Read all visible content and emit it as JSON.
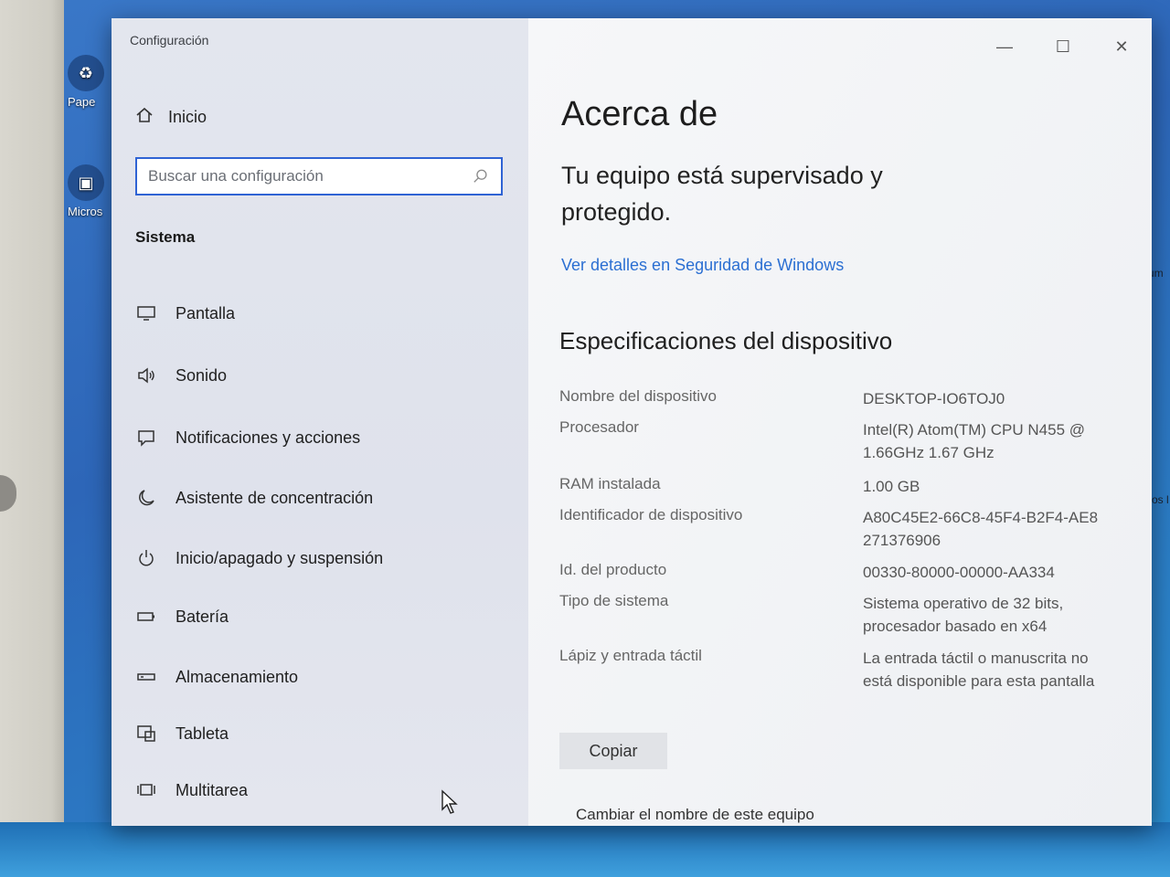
{
  "desktop": {
    "icons": [
      {
        "label": "Pape",
        "icon": "recycle-bin-icon"
      },
      {
        "label": "Micros",
        "icon": "app-shortcut-icon"
      }
    ],
    "right_fragments": [
      "cum",
      "mos l"
    ]
  },
  "window": {
    "title": "Configuración",
    "controls": {
      "minimize": "—",
      "maximize": "☐",
      "close": "✕"
    }
  },
  "sidebar": {
    "home_label": "Inicio",
    "search_placeholder": "Buscar una configuración",
    "section": "Sistema",
    "items": [
      {
        "label": "Pantalla",
        "icon": "monitor-icon"
      },
      {
        "label": "Sonido",
        "icon": "speaker-icon"
      },
      {
        "label": "Notificaciones y acciones",
        "icon": "notification-icon"
      },
      {
        "label": "Asistente de concentración",
        "icon": "moon-icon"
      },
      {
        "label": "Inicio/apagado y suspensión",
        "icon": "power-icon"
      },
      {
        "label": "Batería",
        "icon": "battery-icon"
      },
      {
        "label": "Almacenamiento",
        "icon": "storage-icon"
      },
      {
        "label": "Tableta",
        "icon": "tablet-icon"
      },
      {
        "label": "Multitarea",
        "icon": "multitask-icon"
      }
    ]
  },
  "main": {
    "title": "Acerca de",
    "status": "Tu equipo está supervisado y protegido.",
    "security_link": "Ver detalles en Seguridad de Windows",
    "specs_title": "Especificaciones del dispositivo",
    "specs": [
      {
        "label": "Nombre del dispositivo",
        "value": "DESKTOP-IO6TOJ0"
      },
      {
        "label": "Procesador",
        "value": "Intel(R) Atom(TM) CPU N455 @ 1.66GHz   1.67 GHz"
      },
      {
        "label": "RAM instalada",
        "value": "1.00 GB"
      },
      {
        "label": "Identificador de dispositivo",
        "value": "A80C45E2-66C8-45F4-B2F4-AE8271376906"
      },
      {
        "label": "Id. del producto",
        "value": "00330-80000-00000-AA334"
      },
      {
        "label": "Tipo de sistema",
        "value": "Sistema operativo de 32 bits, procesador basado en x64"
      },
      {
        "label": "Lápiz y entrada táctil",
        "value": "La entrada táctil o manuscrita no está disponible para esta pantalla"
      }
    ],
    "copy_label": "Copiar",
    "rename_label": "Cambiar el nombre de este equipo"
  }
}
